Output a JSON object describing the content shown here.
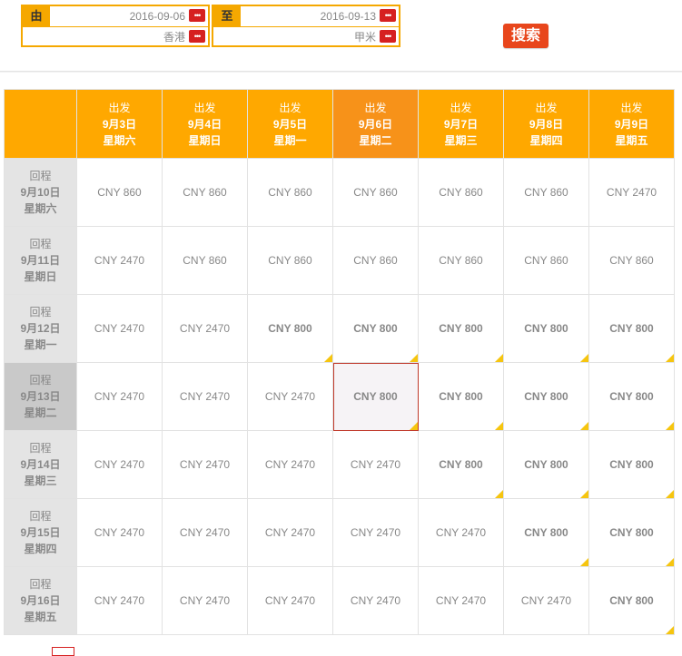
{
  "search": {
    "from_label": "由",
    "to_label": "至",
    "depart_date": "2016-09-06",
    "return_date": "2016-09-13",
    "origin": "香港",
    "destination": "甲米",
    "button_label": "搜索"
  },
  "matrix": {
    "header_top": "出发",
    "columns": [
      {
        "date": "9月3日",
        "weekday": "星期六"
      },
      {
        "date": "9月4日",
        "weekday": "星期日"
      },
      {
        "date": "9月5日",
        "weekday": "星期一"
      },
      {
        "date": "9月6日",
        "weekday": "星期二"
      },
      {
        "date": "9月7日",
        "weekday": "星期三"
      },
      {
        "date": "9月8日",
        "weekday": "星期四"
      },
      {
        "date": "9月9日",
        "weekday": "星期五"
      }
    ],
    "row_top": "回程",
    "rows": [
      {
        "date": "9月10日",
        "weekday": "星期六",
        "prices": [
          "CNY 860",
          "CNY 860",
          "CNY 860",
          "CNY 860",
          "CNY 860",
          "CNY 860",
          "CNY 2470"
        ]
      },
      {
        "date": "9月11日",
        "weekday": "星期日",
        "prices": [
          "CNY 2470",
          "CNY 860",
          "CNY 860",
          "CNY 860",
          "CNY 860",
          "CNY 860",
          "CNY 860"
        ]
      },
      {
        "date": "9月12日",
        "weekday": "星期一",
        "prices": [
          "CNY 2470",
          "CNY 2470",
          "CNY 800",
          "CNY 800",
          "CNY 800",
          "CNY 800",
          "CNY 800"
        ]
      },
      {
        "date": "9月13日",
        "weekday": "星期二",
        "prices": [
          "CNY 2470",
          "CNY 2470",
          "CNY 2470",
          "CNY 800",
          "CNY 800",
          "CNY 800",
          "CNY 800"
        ]
      },
      {
        "date": "9月14日",
        "weekday": "星期三",
        "prices": [
          "CNY 2470",
          "CNY 2470",
          "CNY 2470",
          "CNY 2470",
          "CNY 800",
          "CNY 800",
          "CNY 800"
        ]
      },
      {
        "date": "9月15日",
        "weekday": "星期四",
        "prices": [
          "CNY 2470",
          "CNY 2470",
          "CNY 2470",
          "CNY 2470",
          "CNY 2470",
          "CNY 800",
          "CNY 800"
        ]
      },
      {
        "date": "9月16日",
        "weekday": "星期五",
        "prices": [
          "CNY 2470",
          "CNY 2470",
          "CNY 2470",
          "CNY 2470",
          "CNY 2470",
          "CNY 2470",
          "CNY 800"
        ]
      }
    ],
    "selected_column": 3,
    "selected_row": 3,
    "lowest_price": "CNY 800"
  },
  "colors": {
    "accent": "#ffa800",
    "selected_header": "#f79219",
    "search_button": "#e8461c",
    "low_price_marker": "#f6c50f",
    "selection_border": "#c0392b"
  }
}
